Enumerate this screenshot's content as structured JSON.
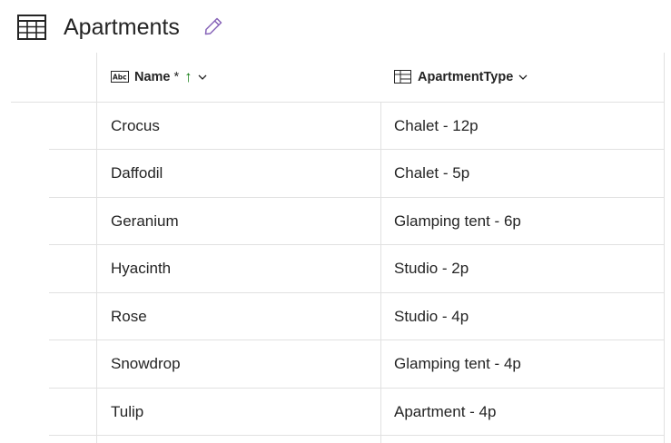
{
  "page": {
    "title": "Apartments"
  },
  "columns": {
    "name": {
      "label": "Name",
      "required_marker": "*",
      "sort_indicator": "↑"
    },
    "type": {
      "label": "ApartmentType"
    }
  },
  "rows": [
    {
      "name": "Crocus",
      "type": "Chalet - 12p"
    },
    {
      "name": "Daffodil",
      "type": "Chalet - 5p"
    },
    {
      "name": "Geranium",
      "type": "Glamping tent - 6p"
    },
    {
      "name": "Hyacinth",
      "type": "Studio - 2p"
    },
    {
      "name": "Rose",
      "type": "Studio - 4p"
    },
    {
      "name": "Snowdrop",
      "type": "Glamping tent - 4p"
    },
    {
      "name": "Tulip",
      "type": "Apartment - 4p"
    }
  ],
  "colors": {
    "text": "#242424",
    "grid_line": "#e1e1e1",
    "sort_arrow": "#107c10",
    "edit_icon": "#8764b8"
  },
  "icons": [
    "table-icon",
    "edit-pencil-icon",
    "text-column-icon",
    "lookup-column-icon",
    "chevron-down-icon"
  ]
}
